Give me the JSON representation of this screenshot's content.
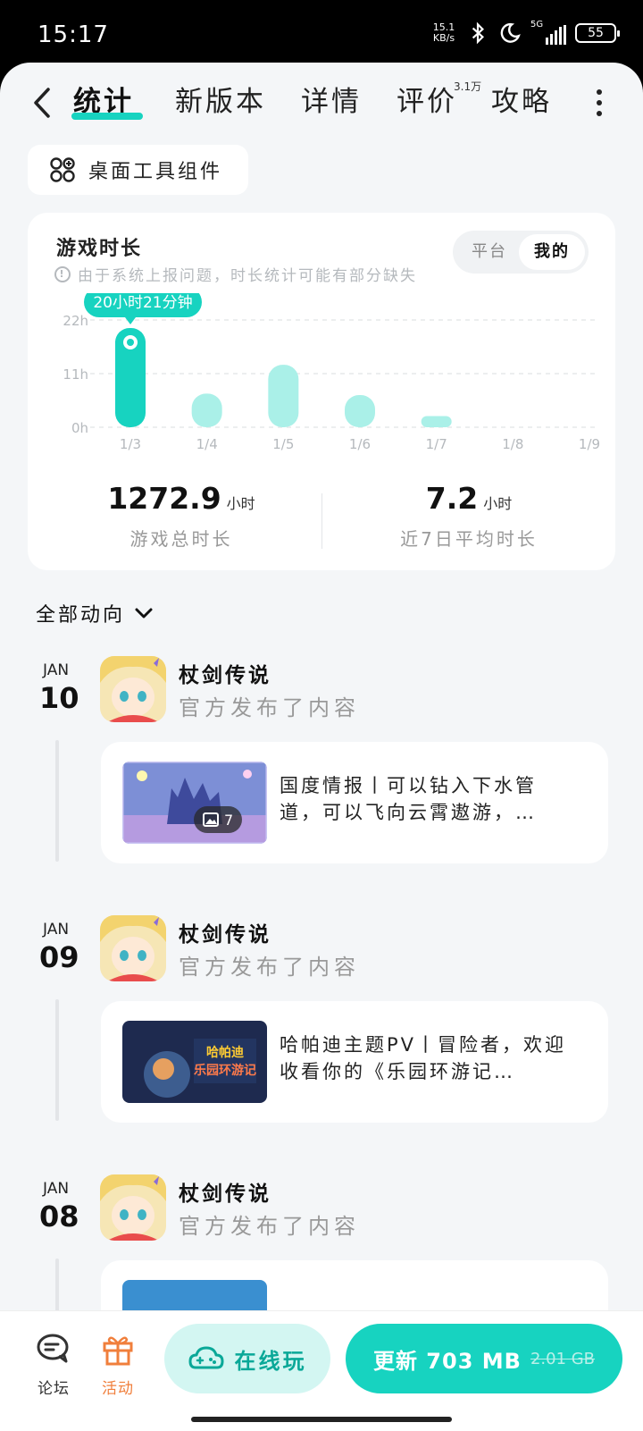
{
  "status_bar": {
    "time": "15:17",
    "net_speed_value": "15.1",
    "net_speed_unit": "KB/s",
    "signal": "5G",
    "battery": "55"
  },
  "nav": {
    "tabs": [
      {
        "label": "统计",
        "active": true
      },
      {
        "label": "新版本"
      },
      {
        "label": "详情"
      },
      {
        "label": "评价",
        "badge": "3.1万"
      },
      {
        "label": "攻略"
      }
    ]
  },
  "widget_button": {
    "label": "桌面工具组件"
  },
  "stats_card": {
    "title": "游戏时长",
    "note": "由于系统上报问题，时长统计可能有部分缺失",
    "toggle": {
      "platform": "平台",
      "mine": "我的",
      "selected": "mine"
    },
    "tooltip": "20小时21分钟",
    "total": {
      "value": "1272.9",
      "unit": "小时",
      "label": "游戏总时长"
    },
    "avg7": {
      "value": "7.2",
      "unit": "小时",
      "label": "近7日平均时长"
    }
  },
  "chart_data": {
    "type": "bar",
    "categories": [
      "1/3",
      "1/4",
      "1/5",
      "1/6",
      "1/7",
      "1/8",
      "1/9"
    ],
    "values": [
      20.35,
      6.9,
      12.8,
      6.6,
      2.3,
      0,
      0
    ],
    "unit": "h",
    "ylim": [
      0,
      22
    ],
    "yticks": [
      "22h",
      "11h",
      "0h"
    ],
    "highlight_index": 0,
    "grid": true,
    "colors": {
      "highlight": "#17d3c0",
      "normal": "#aaf0e8"
    }
  },
  "feed": {
    "filter_label": "全部动向",
    "items": [
      {
        "month": "JAN",
        "day": "10",
        "game": "杖剑传说",
        "action": "官方发布了内容",
        "text": "国度情报丨可以钻入下水管道，可以飞向云霄遨游，…",
        "image_count": "7"
      },
      {
        "month": "JAN",
        "day": "09",
        "game": "杖剑传说",
        "action": "官方发布了内容",
        "text": "哈帕迪主题PV丨冒险者，欢迎收看你的《乐园环游记…",
        "thumb_caption": "哈帕迪 乐园环游记"
      },
      {
        "month": "JAN",
        "day": "08",
        "game": "杖剑传说",
        "action": "官方发布了内容"
      }
    ]
  },
  "bottom_bar": {
    "forum": "论坛",
    "activity": "活动",
    "play_online": "在线玩",
    "update": "更新 703 MB",
    "update_old_size": "2.01 GB"
  },
  "colors": {
    "accent": "#17d3c0",
    "activity": "#f07f3c"
  }
}
